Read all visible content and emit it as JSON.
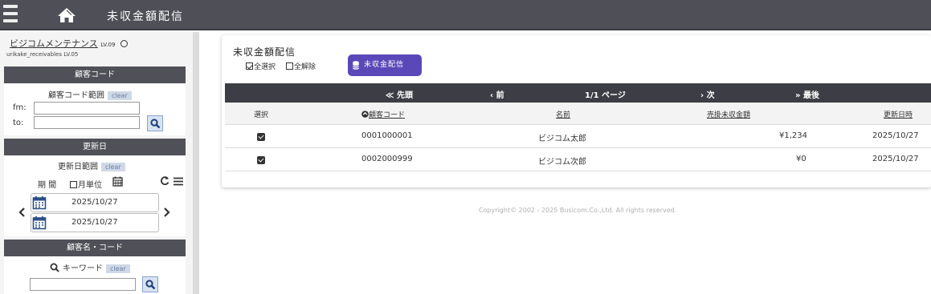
{
  "header": {
    "app_title": "未収金額配信"
  },
  "sidebar": {
    "user": {
      "name": "ビジコムメンテナンス",
      "level": "LV.09",
      "account": "urikake_receivables LV.05"
    },
    "customer_code_panel": {
      "title": "顧客コード",
      "range_label": "顧客コード範囲",
      "clear_label": "clear",
      "fm_label": "fm:",
      "to_label": "to:",
      "fm_value": "",
      "to_value": ""
    },
    "updated_panel": {
      "title": "更新日",
      "range_label": "更新日範囲",
      "clear_label": "clear",
      "period_label": "期 間",
      "monthly_label": "月単位",
      "date_from": "2025/10/27",
      "date_to": "2025/10/27"
    },
    "name_panel": {
      "title": "顧客名・コード",
      "keyword_label": "キーワード",
      "clear_label": "clear",
      "keyword_value": ""
    }
  },
  "main": {
    "title": "未収金額配信",
    "select_all": "全選択",
    "deselect_all": "全解除",
    "send_button": "未収金配信",
    "pager": {
      "first": "≪ 先頭",
      "prev": "‹ 前",
      "page_info": "1/1 ページ",
      "next": "› 次",
      "last": "» 最後"
    },
    "columns": {
      "select": "選択",
      "code": "顧客コード",
      "name": "名前",
      "amount": "売掛未収金額",
      "updated": "更新日時"
    },
    "rows": [
      {
        "selected": true,
        "code": "0001000001",
        "name": "ビジコム太郎",
        "amount": "¥1,234",
        "updated": "2025/10/27"
      },
      {
        "selected": true,
        "code": "0002000999",
        "name": "ビジコム次郎",
        "amount": "¥0",
        "updated": "2025/10/27"
      }
    ]
  },
  "footer": {
    "copyright": "Copyright© 2002 - 2025 Busicom.Co.,Ltd. All rights reserved."
  },
  "colors": {
    "topbar": "#4f4f58",
    "accent_button": "#5b48b8",
    "panel_header": "#505058",
    "pager": "#3d3d45"
  }
}
